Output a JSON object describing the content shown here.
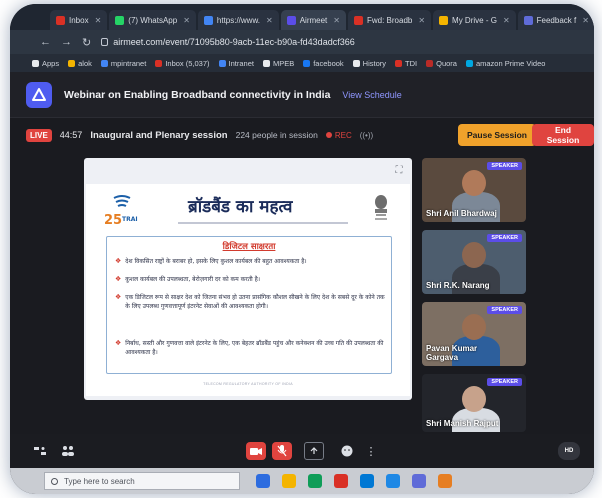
{
  "browser": {
    "tabs": [
      {
        "label": "Inbox",
        "color": "#d93025"
      },
      {
        "label": "(7) WhatsApp",
        "color": "#25d366"
      },
      {
        "label": "https://www.",
        "color": "#4285f4"
      },
      {
        "label": "Airmeet",
        "color": "#5b4de8",
        "active": true
      },
      {
        "label": "Fwd: Broadb",
        "color": "#d93025"
      },
      {
        "label": "My Drive - G",
        "color": "#f4b400"
      },
      {
        "label": "Feedback f",
        "color": "#5f6bd8"
      }
    ],
    "url": "airmeet.com/event/71095b80-9acb-11ec-b90a-fd43dadcf366",
    "bookmarks": [
      {
        "label": "Apps",
        "color": "#e8eaed"
      },
      {
        "label": "alok",
        "color": "#f4b400"
      },
      {
        "label": "mpintranet",
        "color": "#4285f4"
      },
      {
        "label": "Inbox (5,037)",
        "color": "#d93025"
      },
      {
        "label": "Intranet",
        "color": "#4285f4"
      },
      {
        "label": "MPEB",
        "color": "#e8eaed"
      },
      {
        "label": "facebook",
        "color": "#1877f2"
      },
      {
        "label": "History",
        "color": "#e8eaed"
      },
      {
        "label": "TDI",
        "color": "#d93025"
      },
      {
        "label": "Quora",
        "color": "#b92b27"
      },
      {
        "label": "amazon Prime Video",
        "color": "#00a8e1"
      }
    ]
  },
  "event": {
    "title": "Webinar on Enabling Broadband connectivity in India",
    "view_schedule": "View Schedule"
  },
  "session": {
    "live": "LIVE",
    "timer": "44:57",
    "name": "Inaugural and Plenary session",
    "people": "224 people in session",
    "rec": "REC",
    "pause": "Pause Session",
    "end": "End Session"
  },
  "slide": {
    "logo_text": "TRAI",
    "title": "ब्रॉडबैंड का महत्व",
    "box_heading": "डिजिटल साक्षरता",
    "bullets": [
      "देश विकसित राष्ट्रों के बराबर हो, इसके लिए कुशल कार्यबल की बहुत आवश्यकता है।",
      "कुशल कार्यबल की उपलब्धता, बेरोज़गारी दर को कम करती है।",
      "एक डिजिटल रूप से साक्षर देश को जितना संभव हो उतना प्रासंगिक कौशल सीखने के लिए देश के सबसे दूर के कोने तक के लिए उपलब्ध गुणवत्तापूर्ण इंटरनेट सेवाओं की आवश्यकता होगी।",
      "निर्बाध, सस्ती और गुणवत्ता वाले इंटरनेट के लिए, एक बेहतर ब्रॉडबैंड पहुंच और कनेक्शन की उच्च गति की उपलब्धता की आवश्यकता है।"
    ],
    "footer": "TELECOM REGULATORY AUTHORITY OF INDIA"
  },
  "speakers": [
    {
      "badge": "SPEAKER",
      "name": "Shri Anil Bhardwaj",
      "bg": "#5a4a3e",
      "skin": "#b07a5a",
      "shirt": "#7c8897"
    },
    {
      "badge": "SPEAKER",
      "name": "Shri R.K. Narang",
      "bg": "#4d5d6e",
      "skin": "#8c6650",
      "shirt": "#3a3f48"
    },
    {
      "badge": "SPEAKER",
      "name": "Pavan Kumar\nGargava",
      "bg": "#7d6f63",
      "skin": "#9a6e52",
      "shirt": "#2d5f9c"
    },
    {
      "badge": "SPEAKER",
      "name": "Shri Manish Rajput",
      "bg": "#23252b",
      "skin": "#c7a28b",
      "shirt": "#d8dce2"
    }
  ],
  "controls": {
    "hd": "HD"
  },
  "taskbar": {
    "search_placeholder": "Type here to search",
    "icons": [
      "#2d6cdf",
      "#f4b400",
      "#0f9d58",
      "#d93025",
      "#0078d4",
      "#1e88e5",
      "#5f6bd8",
      "#e67e22"
    ]
  }
}
